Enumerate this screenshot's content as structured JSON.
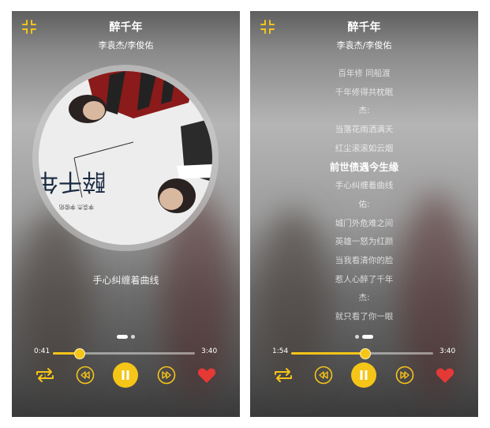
{
  "song": {
    "title": "醉千年",
    "artist": "李袁杰/李俊佑"
  },
  "left_screen": {
    "current_lyric": "手心纠缠着曲线",
    "elapsed": "0:41",
    "duration": "3:40",
    "progress": 0.186,
    "page_indicator": {
      "active_index": 0,
      "count": 2
    }
  },
  "right_screen": {
    "elapsed": "1:54",
    "duration": "3:40",
    "progress": 0.518,
    "page_indicator": {
      "active_index": 1,
      "count": 2
    },
    "lyrics": [
      "百年修 同船渡",
      "千年修得共枕眠",
      "杰:",
      "当落花雨洒满天",
      "红尘滚滚如云烟",
      "前世债遇今生缘",
      "手心纠缠着曲线",
      "佑:",
      "城门外危难之间",
      "英雄一怒为红颜",
      "当我看清你的脸",
      "惹人心醉了千年",
      "杰:",
      "就只看了你一眼"
    ],
    "current_line_index": 5
  },
  "icons": {
    "collapse": "collapse-arrows-icon",
    "repeat": "repeat-one-icon",
    "previous": "previous-track-icon",
    "pause": "pause-icon",
    "next": "next-track-icon",
    "favorite": "heart-icon"
  },
  "colors": {
    "accent": "#f5c518",
    "favorite": "#e53935"
  }
}
